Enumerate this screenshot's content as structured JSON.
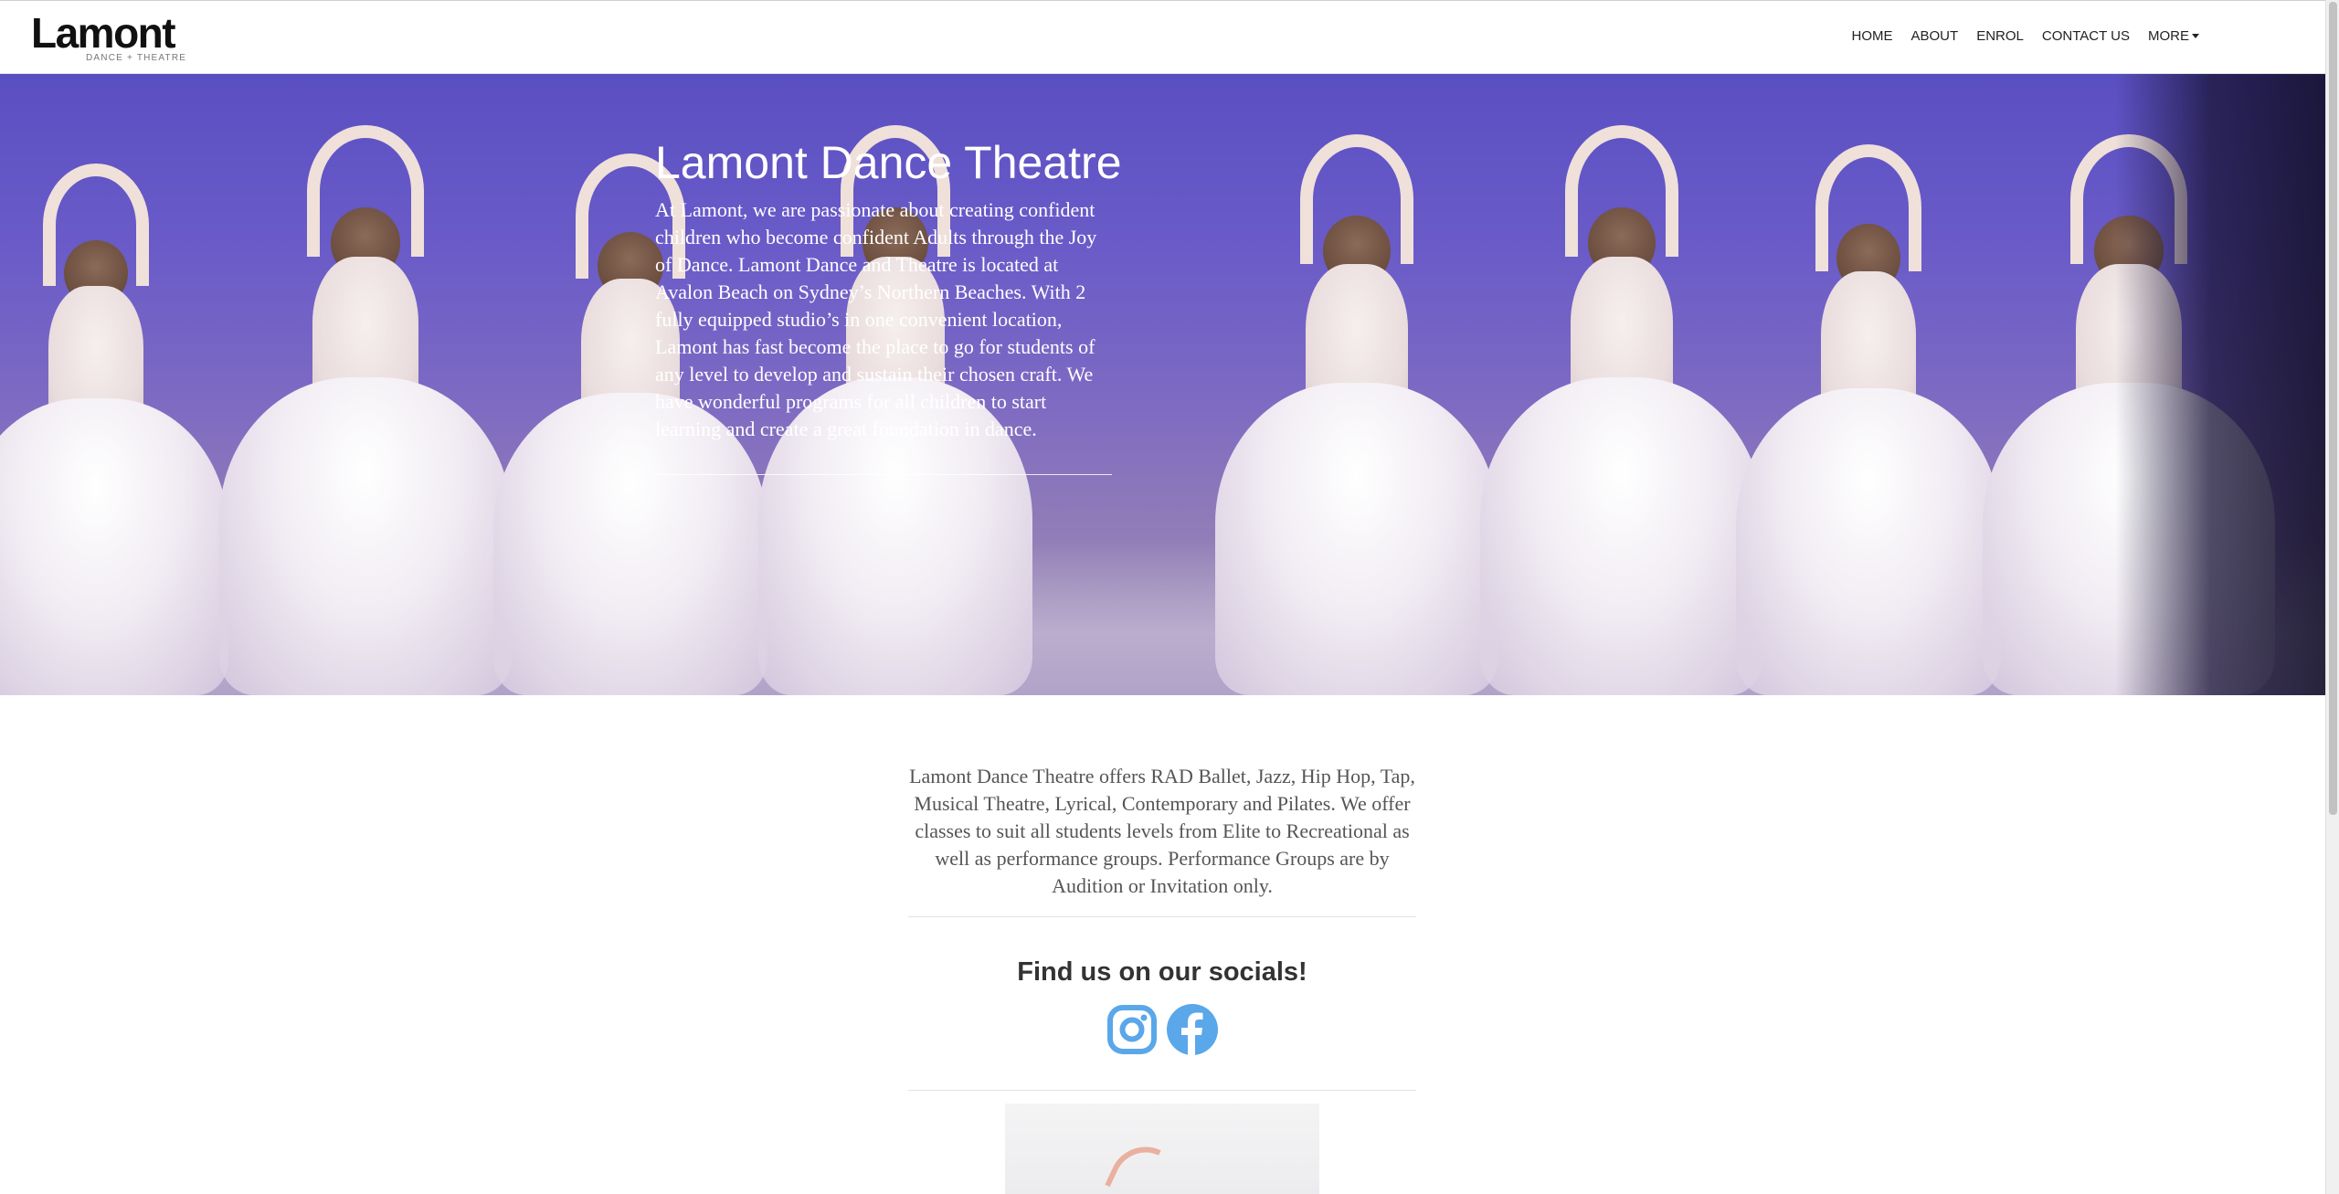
{
  "brand": {
    "logo_text": "Lamont",
    "logo_subtext": "DANCE  +  THEATRE"
  },
  "nav": {
    "items": [
      {
        "label": "HOME"
      },
      {
        "label": "ABOUT"
      },
      {
        "label": "ENROL"
      },
      {
        "label": "CONTACT US"
      },
      {
        "label": "MORE"
      }
    ]
  },
  "hero": {
    "title": "Lamont Dance Theatre",
    "text": "At Lamont, we are passionate about creating confident children who become confident Adults through the Joy of Dance. Lamont Dance and Theatre is located at Avalon Beach on Sydney’s Northern Beaches. With 2 fully equipped studio’s in one convenient location, Lamont has fast become the place to go for students of any level to develop and sustain their chosen craft. We have wonderful programs for all children to start learning and create a great foundation in dance."
  },
  "main": {
    "offer_text": "Lamont Dance Theatre offers RAD Ballet, Jazz, Hip Hop, Tap, Musical Theatre, Lyrical, Contemporary and Pilates. We offer classes to suit all students levels from Elite to Recreational as well as performance groups. Performance Groups are by Audition or Invitation only.",
    "socials_heading": "Find us on our socials!",
    "social_icons": [
      "instagram-icon",
      "facebook-icon"
    ]
  },
  "colors": {
    "social_blue": "#5aa7ea",
    "hero_purple": "#5a4fc2"
  }
}
